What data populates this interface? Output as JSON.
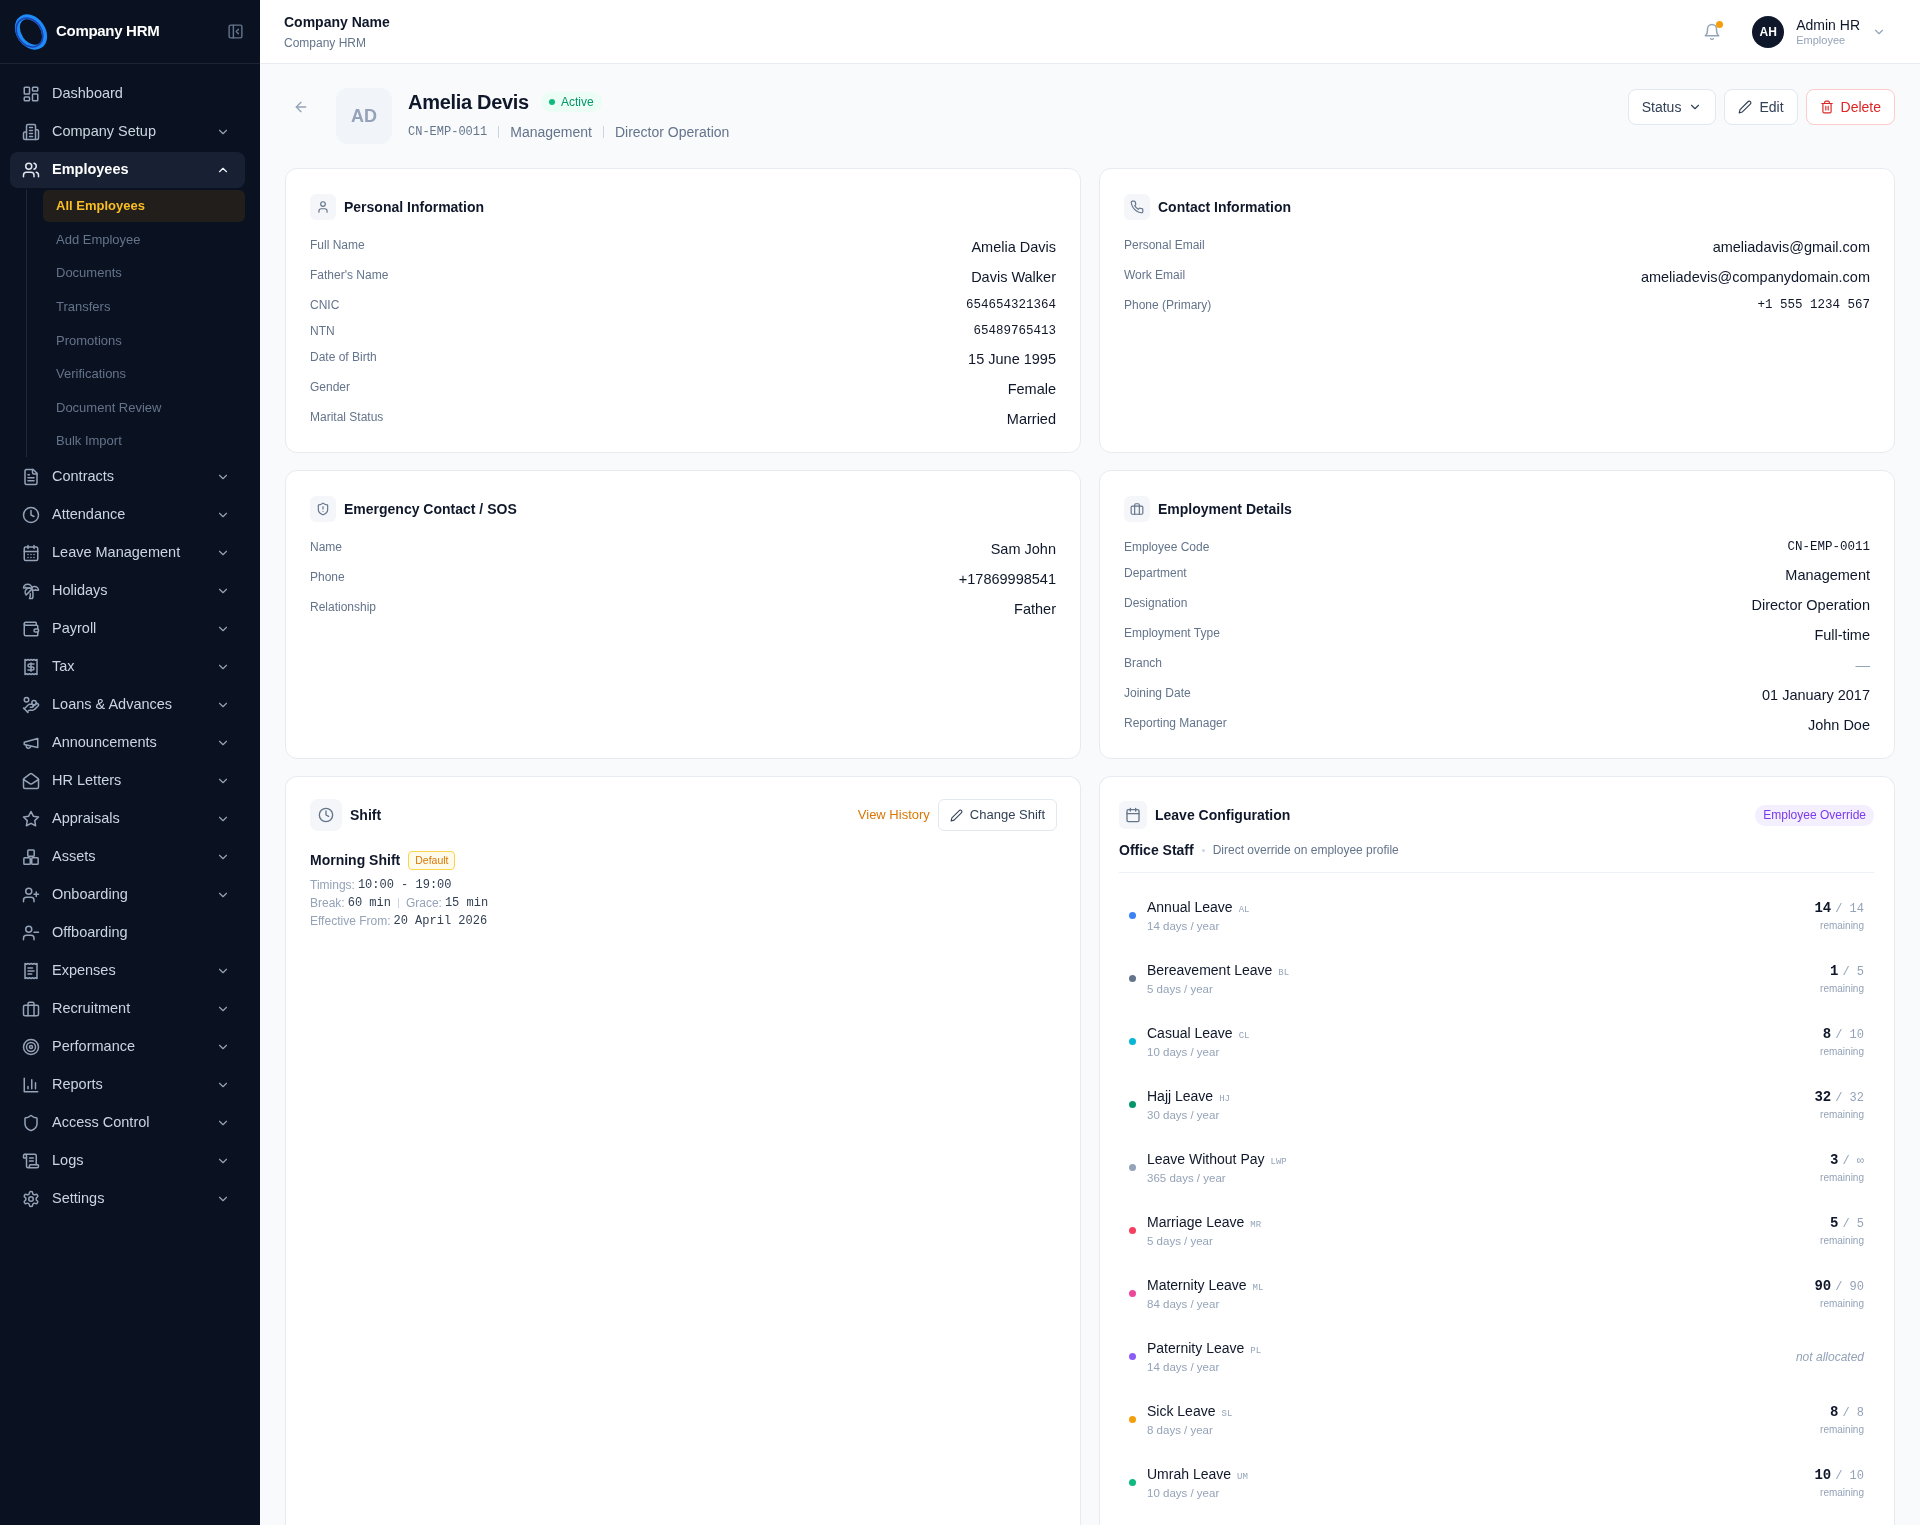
{
  "sidebar": {
    "brand": "Company HRM",
    "items": [
      {
        "label": "Dashboard",
        "expandable": false,
        "expanded": false,
        "selected": false
      },
      {
        "label": "Company Setup",
        "expandable": true,
        "expanded": false,
        "selected": false
      },
      {
        "label": "Employees",
        "expandable": true,
        "expanded": true,
        "selected": true,
        "children": [
          {
            "label": "All Employees",
            "selected": true
          },
          {
            "label": "Add Employee",
            "selected": false
          },
          {
            "label": "Documents",
            "selected": false
          },
          {
            "label": "Transfers",
            "selected": false
          },
          {
            "label": "Promotions",
            "selected": false
          },
          {
            "label": "Verifications",
            "selected": false
          },
          {
            "label": "Document Review",
            "selected": false
          },
          {
            "label": "Bulk Import",
            "selected": false
          }
        ]
      },
      {
        "label": "Contracts",
        "expandable": true,
        "expanded": false,
        "selected": false
      },
      {
        "label": "Attendance",
        "expandable": true,
        "expanded": false,
        "selected": false
      },
      {
        "label": "Leave Management",
        "expandable": true,
        "expanded": false,
        "selected": false
      },
      {
        "label": "Holidays",
        "expandable": true,
        "expanded": false,
        "selected": false
      },
      {
        "label": "Payroll",
        "expandable": true,
        "expanded": false,
        "selected": false
      },
      {
        "label": "Tax",
        "expandable": true,
        "expanded": false,
        "selected": false
      },
      {
        "label": "Loans & Advances",
        "expandable": true,
        "expanded": false,
        "selected": false
      },
      {
        "label": "Announcements",
        "expandable": true,
        "expanded": false,
        "selected": false
      },
      {
        "label": "HR Letters",
        "expandable": true,
        "expanded": false,
        "selected": false
      },
      {
        "label": "Appraisals",
        "expandable": true,
        "expanded": false,
        "selected": false
      },
      {
        "label": "Assets",
        "expandable": true,
        "expanded": false,
        "selected": false
      },
      {
        "label": "Onboarding",
        "expandable": true,
        "expanded": false,
        "selected": false
      },
      {
        "label": "Offboarding",
        "expandable": false,
        "expanded": false,
        "selected": false
      },
      {
        "label": "Expenses",
        "expandable": true,
        "expanded": false,
        "selected": false
      },
      {
        "label": "Recruitment",
        "expandable": true,
        "expanded": false,
        "selected": false
      },
      {
        "label": "Performance",
        "expandable": true,
        "expanded": false,
        "selected": false
      },
      {
        "label": "Reports",
        "expandable": true,
        "expanded": false,
        "selected": false
      },
      {
        "label": "Access Control",
        "expandable": true,
        "expanded": false,
        "selected": false
      },
      {
        "label": "Logs",
        "expandable": true,
        "expanded": false,
        "selected": false
      },
      {
        "label": "Settings",
        "expandable": true,
        "expanded": false,
        "selected": false
      }
    ]
  },
  "header": {
    "title": "Company Name",
    "subtitle": "Company HRM",
    "notifications": {
      "unread": true
    },
    "user": {
      "initials": "AH",
      "name": "Admin HR",
      "role": "Employee"
    }
  },
  "profile": {
    "initials": "AD",
    "name": "Amelia Devis",
    "status": {
      "label": "Active",
      "kind": "active"
    },
    "meta": [
      {
        "text": "CN-EMP-0011",
        "kind": "mono"
      },
      {
        "text": "Management",
        "kind": "text"
      },
      {
        "text": "Director Operation",
        "kind": "text"
      }
    ],
    "actions": [
      {
        "label": "Status",
        "kind": "dropdown"
      },
      {
        "label": "Edit",
        "kind": "edit"
      },
      {
        "label": "Delete",
        "kind": "delete"
      }
    ]
  },
  "cards": [
    {
      "kind": "fields",
      "title": "Personal Information",
      "fields": [
        {
          "label": "Full Name",
          "value": "Amelia Davis",
          "kind": "text"
        },
        {
          "label": "Father's Name",
          "value": "Davis Walker",
          "kind": "text"
        },
        {
          "label": "CNIC",
          "value": "654654321364",
          "kind": "mono"
        },
        {
          "label": "NTN",
          "value": "65489765413",
          "kind": "mono"
        },
        {
          "label": "Date of Birth",
          "value": "15 June 1995",
          "kind": "text"
        },
        {
          "label": "Gender",
          "value": "Female",
          "kind": "text"
        },
        {
          "label": "Marital Status",
          "value": "Married",
          "kind": "text"
        }
      ]
    },
    {
      "kind": "fields",
      "title": "Contact Information",
      "fields": [
        {
          "label": "Personal Email",
          "value": "ameliadavis@gmail.com",
          "kind": "text"
        },
        {
          "label": "Work Email",
          "value": "ameliadevis@companydomain.com",
          "kind": "text"
        },
        {
          "label": "Phone (Primary)",
          "value": "+1 555 1234 567",
          "kind": "mono"
        }
      ]
    },
    {
      "kind": "fields",
      "title": "Emergency Contact / SOS",
      "fields": [
        {
          "label": "Name",
          "value": "Sam John",
          "kind": "text"
        },
        {
          "label": "Phone",
          "value": "+17869998541",
          "kind": "text"
        },
        {
          "label": "Relationship",
          "value": "Father",
          "kind": "text"
        }
      ]
    },
    {
      "kind": "fields",
      "title": "Employment Details",
      "fields": [
        {
          "label": "Employee Code",
          "value": "CN-EMP-0011",
          "kind": "mono"
        },
        {
          "label": "Department",
          "value": "Management",
          "kind": "text"
        },
        {
          "label": "Designation",
          "value": "Director Operation",
          "kind": "text"
        },
        {
          "label": "Employment Type",
          "value": "Full-time",
          "kind": "text"
        },
        {
          "label": "Branch",
          "value": "—",
          "kind": "muted"
        },
        {
          "label": "Joining Date",
          "value": "01 January 2017",
          "kind": "text"
        },
        {
          "label": "Reporting Manager",
          "value": "John Doe",
          "kind": "text"
        }
      ]
    },
    {
      "kind": "shift",
      "title": "Shift",
      "history_link": "View History",
      "change_button": "Change Shift",
      "name": "Morning Shift",
      "badge": "Default",
      "details": [
        {
          "items": [
            {
              "label": "Timings:",
              "value": "10:00 - 19:00"
            }
          ]
        },
        {
          "items": [
            {
              "label": "Break:",
              "value": "60 min"
            },
            {
              "label": "Grace:",
              "value": "15 min"
            }
          ]
        },
        {
          "items": [
            {
              "label": "Effective From:",
              "value": "20 April 2026"
            }
          ]
        }
      ]
    },
    {
      "kind": "leave",
      "title": "Leave Configuration",
      "badge": "Employee Override",
      "policy": "Office Staff",
      "note": "Direct override on employee profile",
      "leaves": [
        {
          "name": "Annual Leave",
          "code": "AL",
          "allowance": "14 days / year",
          "kind": "allocated",
          "remaining": "14",
          "total": "/ 14",
          "caption": "remaining",
          "color": "#3b82f6"
        },
        {
          "name": "Bereavement Leave",
          "code": "BL",
          "allowance": "5 days / year",
          "kind": "allocated",
          "remaining": "1",
          "total": "/ 5",
          "caption": "remaining",
          "color": "#64748b"
        },
        {
          "name": "Casual Leave",
          "code": "CL",
          "allowance": "10 days / year",
          "kind": "allocated",
          "remaining": "8",
          "total": "/ 10",
          "caption": "remaining",
          "color": "#06b6d4"
        },
        {
          "name": "Hajj Leave",
          "code": "HJ",
          "allowance": "30 days / year",
          "kind": "allocated",
          "remaining": "32",
          "total": "/ 32",
          "caption": "remaining",
          "color": "#059669"
        },
        {
          "name": "Leave Without Pay",
          "code": "LWP",
          "allowance": "365 days / year",
          "kind": "allocated",
          "remaining": "3",
          "total": "/ ∞",
          "caption": "remaining",
          "color": "#94a3b8"
        },
        {
          "name": "Marriage Leave",
          "code": "MR",
          "allowance": "5 days / year",
          "kind": "allocated",
          "remaining": "5",
          "total": "/ 5",
          "caption": "remaining",
          "color": "#f43f5e"
        },
        {
          "name": "Maternity Leave",
          "code": "ML",
          "allowance": "84 days / year",
          "kind": "allocated",
          "remaining": "90",
          "total": "/ 90",
          "caption": "remaining",
          "color": "#ec4899"
        },
        {
          "name": "Paternity Leave",
          "code": "PL",
          "allowance": "14 days / year",
          "kind": "unallocated",
          "status_text": "not allocated",
          "color": "#8b5cf6"
        },
        {
          "name": "Sick Leave",
          "code": "SL",
          "allowance": "8 days / year",
          "kind": "allocated",
          "remaining": "8",
          "total": "/ 8",
          "caption": "remaining",
          "color": "#f59e0b"
        },
        {
          "name": "Umrah Leave",
          "code": "UM",
          "allowance": "10 days / year",
          "kind": "allocated",
          "remaining": "10",
          "total": "/ 10",
          "caption": "remaining",
          "color": "#10b981"
        }
      ]
    }
  ]
}
